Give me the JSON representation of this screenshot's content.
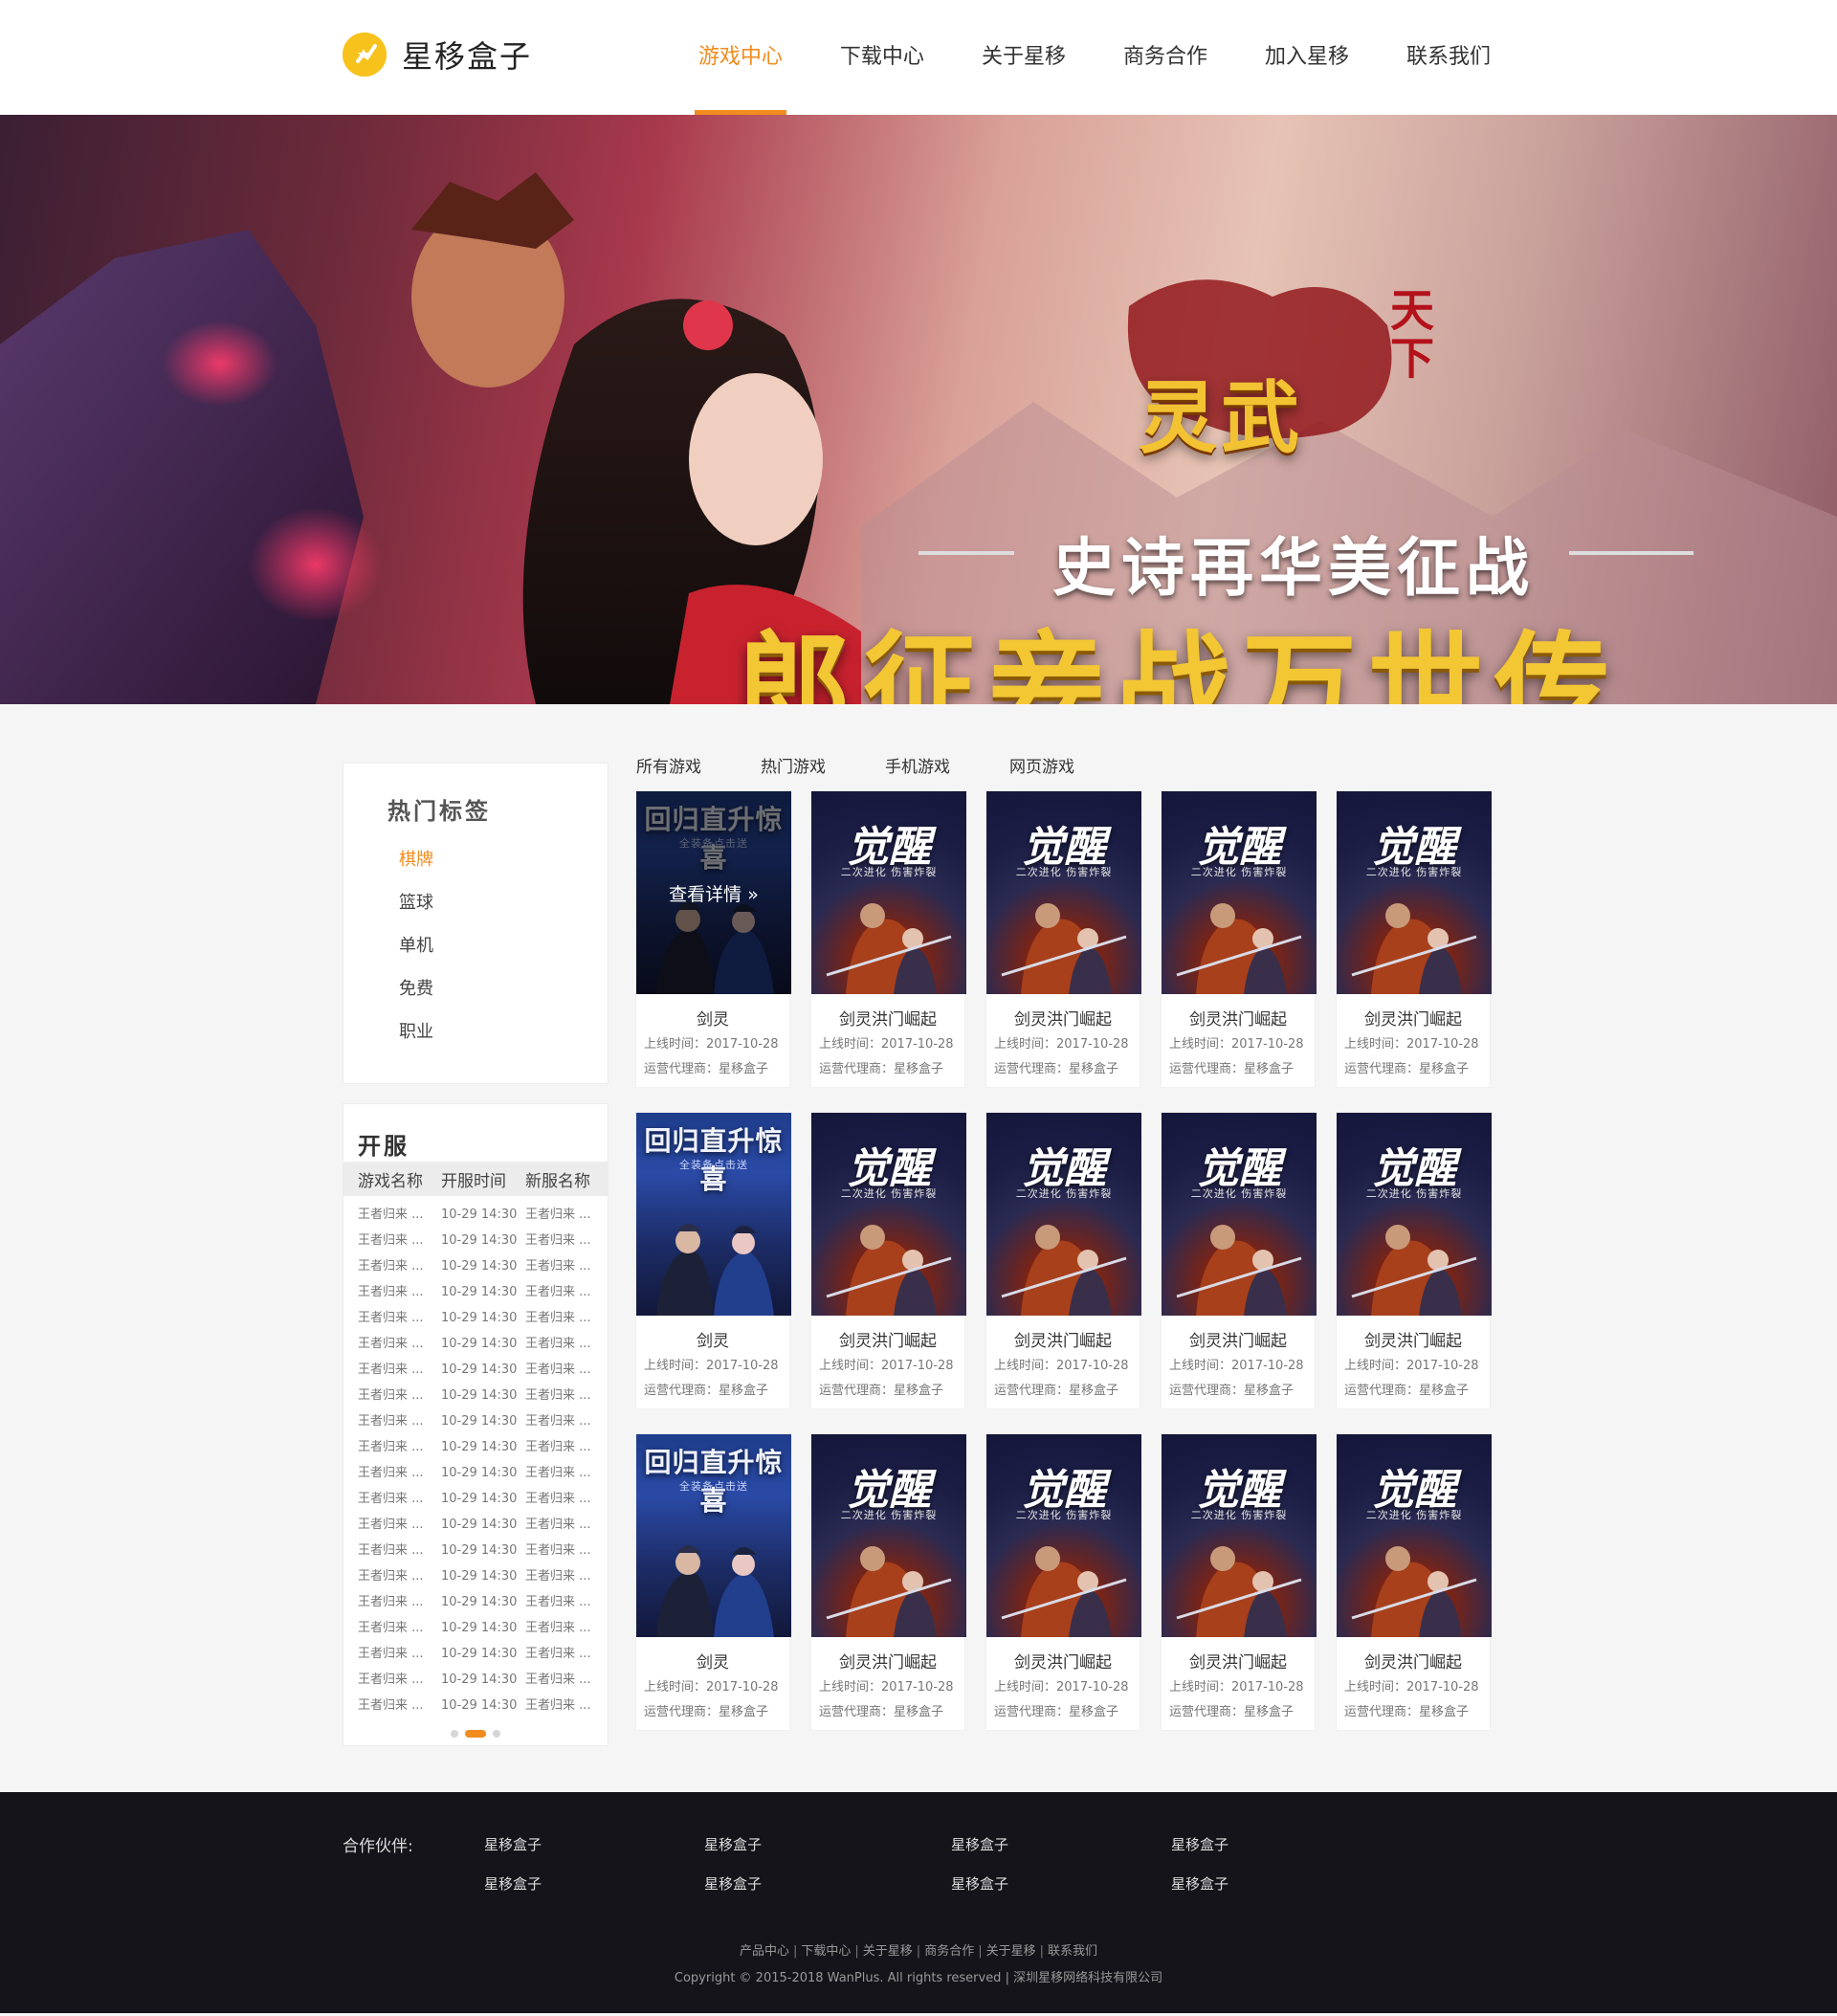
{
  "brand": {
    "name": "星移盒子",
    "accent": "#f28c1f",
    "logo_color": "#f7c21c"
  },
  "nav": {
    "items": [
      {
        "label": "游戏中心",
        "active": true
      },
      {
        "label": "下载中心",
        "active": false
      },
      {
        "label": "关于星移",
        "active": false
      },
      {
        "label": "商务合作",
        "active": false
      },
      {
        "label": "加入星移",
        "active": false
      },
      {
        "label": "联系我们",
        "active": false
      }
    ]
  },
  "banner": {
    "logo_text": "灵武",
    "seal_text": "天下",
    "subtitle": "史诗再华美征战",
    "title": "郎征妾战万世传"
  },
  "sidebar": {
    "tags_title": "热门标签",
    "tags": [
      {
        "label": "棋牌",
        "active": true
      },
      {
        "label": "篮球",
        "active": false
      },
      {
        "label": "单机",
        "active": false
      },
      {
        "label": "免费",
        "active": false
      },
      {
        "label": "职业",
        "active": false
      }
    ],
    "server_title": "开服",
    "server_columns": [
      "游戏名称",
      "开服时间",
      "新服名称"
    ],
    "server_rows": [
      [
        "王者归来 ...",
        "10-29 14:30",
        "王者归来 ..."
      ],
      [
        "王者归来 ...",
        "10-29 14:30",
        "王者归来 ..."
      ],
      [
        "王者归来 ...",
        "10-29 14:30",
        "王者归来 ..."
      ],
      [
        "王者归来 ...",
        "10-29 14:30",
        "王者归来 ..."
      ],
      [
        "王者归来 ...",
        "10-29 14:30",
        "王者归来 ..."
      ],
      [
        "王者归来 ...",
        "10-29 14:30",
        "王者归来 ..."
      ],
      [
        "王者归来 ...",
        "10-29 14:30",
        "王者归来 ..."
      ],
      [
        "王者归来 ...",
        "10-29 14:30",
        "王者归来 ..."
      ],
      [
        "王者归来 ...",
        "10-29 14:30",
        "王者归来 ..."
      ],
      [
        "王者归来 ...",
        "10-29 14:30",
        "王者归来 ..."
      ],
      [
        "王者归来 ...",
        "10-29 14:30",
        "王者归来 ..."
      ],
      [
        "王者归来 ...",
        "10-29 14:30",
        "王者归来 ..."
      ],
      [
        "王者归来 ...",
        "10-29 14:30",
        "王者归来 ..."
      ],
      [
        "王者归来 ...",
        "10-29 14:30",
        "王者归来 ..."
      ],
      [
        "王者归来 ...",
        "10-29 14:30",
        "王者归来 ..."
      ],
      [
        "王者归来 ...",
        "10-29 14:30",
        "王者归来 ..."
      ],
      [
        "王者归来 ...",
        "10-29 14:30",
        "王者归来 ..."
      ],
      [
        "王者归来 ...",
        "10-29 14:30",
        "王者归来 ..."
      ],
      [
        "王者归来 ...",
        "10-29 14:30",
        "王者归来 ..."
      ],
      [
        "王者归来 ...",
        "10-29 14:30",
        "王者归来 ..."
      ]
    ],
    "pager": {
      "count": 3,
      "active": 1
    }
  },
  "content": {
    "tabs": [
      "所有游戏",
      "热门游戏",
      "手机游戏",
      "网页游戏"
    ],
    "detail_label": "查看详情 »",
    "games": [
      {
        "name": "剑灵",
        "date": "上线时间：2017-10-28",
        "agent": "运营代理商：星移盒子",
        "poster": "return",
        "poster_title": "回归直升惊喜",
        "poster_sub": "全装备点击送",
        "hover": true
      },
      {
        "name": "剑灵洪门崛起",
        "date": "上线时间：2017-10-28",
        "agent": "运营代理商：星移盒子",
        "poster": "awaken",
        "poster_title": "觉醒",
        "poster_sub": "二次进化 伤害炸裂",
        "hover": false
      },
      {
        "name": "剑灵洪门崛起",
        "date": "上线时间：2017-10-28",
        "agent": "运营代理商：星移盒子",
        "poster": "awaken",
        "poster_title": "觉醒",
        "poster_sub": "二次进化 伤害炸裂",
        "hover": false
      },
      {
        "name": "剑灵洪门崛起",
        "date": "上线时间：2017-10-28",
        "agent": "运营代理商：星移盒子",
        "poster": "awaken",
        "poster_title": "觉醒",
        "poster_sub": "二次进化 伤害炸裂",
        "hover": false
      },
      {
        "name": "剑灵洪门崛起",
        "date": "上线时间：2017-10-28",
        "agent": "运营代理商：星移盒子",
        "poster": "awaken",
        "poster_title": "觉醒",
        "poster_sub": "二次进化 伤害炸裂",
        "hover": false
      },
      {
        "name": "剑灵",
        "date": "上线时间：2017-10-28",
        "agent": "运营代理商：星移盒子",
        "poster": "return",
        "poster_title": "回归直升惊喜",
        "poster_sub": "全装备点击送",
        "hover": false
      },
      {
        "name": "剑灵洪门崛起",
        "date": "上线时间：2017-10-28",
        "agent": "运营代理商：星移盒子",
        "poster": "awaken",
        "poster_title": "觉醒",
        "poster_sub": "二次进化 伤害炸裂",
        "hover": false
      },
      {
        "name": "剑灵洪门崛起",
        "date": "上线时间：2017-10-28",
        "agent": "运营代理商：星移盒子",
        "poster": "awaken",
        "poster_title": "觉醒",
        "poster_sub": "二次进化 伤害炸裂",
        "hover": false
      },
      {
        "name": "剑灵洪门崛起",
        "date": "上线时间：2017-10-28",
        "agent": "运营代理商：星移盒子",
        "poster": "awaken",
        "poster_title": "觉醒",
        "poster_sub": "二次进化 伤害炸裂",
        "hover": false
      },
      {
        "name": "剑灵洪门崛起",
        "date": "上线时间：2017-10-28",
        "agent": "运营代理商：星移盒子",
        "poster": "awaken",
        "poster_title": "觉醒",
        "poster_sub": "二次进化 伤害炸裂",
        "hover": false
      },
      {
        "name": "剑灵",
        "date": "上线时间：2017-10-28",
        "agent": "运营代理商：星移盒子",
        "poster": "return",
        "poster_title": "回归直升惊喜",
        "poster_sub": "全装备点击送",
        "hover": false
      },
      {
        "name": "剑灵洪门崛起",
        "date": "上线时间：2017-10-28",
        "agent": "运营代理商：星移盒子",
        "poster": "awaken",
        "poster_title": "觉醒",
        "poster_sub": "二次进化 伤害炸裂",
        "hover": false
      },
      {
        "name": "剑灵洪门崛起",
        "date": "上线时间：2017-10-28",
        "agent": "运营代理商：星移盒子",
        "poster": "awaken",
        "poster_title": "觉醒",
        "poster_sub": "二次进化 伤害炸裂",
        "hover": false
      },
      {
        "name": "剑灵洪门崛起",
        "date": "上线时间：2017-10-28",
        "agent": "运营代理商：星移盒子",
        "poster": "awaken",
        "poster_title": "觉醒",
        "poster_sub": "二次进化 伤害炸裂",
        "hover": false
      },
      {
        "name": "剑灵洪门崛起",
        "date": "上线时间：2017-10-28",
        "agent": "运营代理商：星移盒子",
        "poster": "awaken",
        "poster_title": "觉醒",
        "poster_sub": "二次进化 伤害炸裂",
        "hover": false
      }
    ]
  },
  "footer": {
    "partners_label": "合作伙伴:",
    "partners": [
      "星移盒子",
      "星移盒子",
      "星移盒子",
      "星移盒子",
      "星移盒子",
      "星移盒子",
      "星移盒子",
      "星移盒子"
    ],
    "links": [
      "产品中心",
      "下载中心",
      "关于星移",
      "商务合作",
      "关于星移",
      "联系我们"
    ],
    "link_separator": "|",
    "copyright": "Copyright © 2015-2018 WanPlus. All rights reserved | 深圳星移网络科技有限公司"
  }
}
